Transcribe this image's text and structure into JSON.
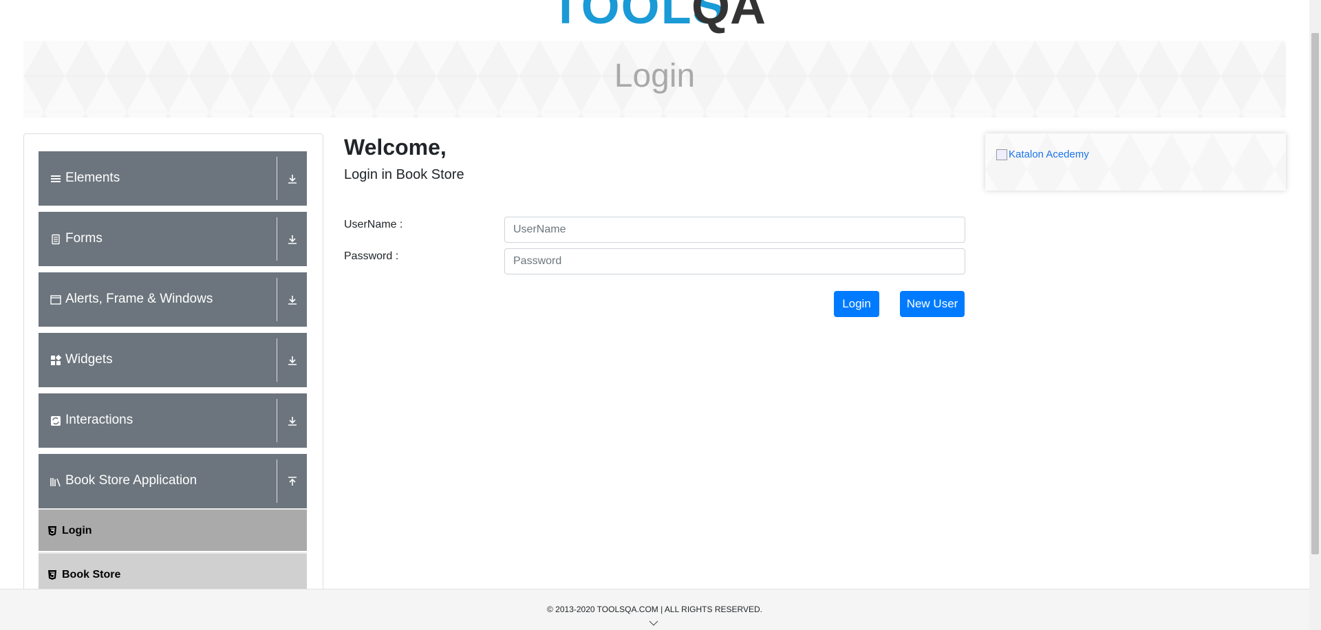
{
  "header": {
    "logo_text": "TOOLS",
    "logo_qa": "QA"
  },
  "banner": {
    "title": "Login"
  },
  "sidebar": {
    "groups": [
      {
        "label": "Elements",
        "icon": "menu-icon",
        "expanded": false
      },
      {
        "label": "Forms",
        "icon": "form-icon",
        "expanded": false
      },
      {
        "label": "Alerts, Frame & Windows",
        "icon": "window-icon",
        "expanded": false
      },
      {
        "label": "Widgets",
        "icon": "widgets-icon",
        "expanded": false
      },
      {
        "label": "Interactions",
        "icon": "interactions-icon",
        "expanded": false
      },
      {
        "label": "Book Store Application",
        "icon": "books-icon",
        "expanded": true
      }
    ],
    "sub_items": [
      {
        "label": "Login",
        "active": true
      },
      {
        "label": "Book Store",
        "active": false
      }
    ]
  },
  "main": {
    "welcome": "Welcome,",
    "subtitle": "Login in Book Store",
    "username_label": "UserName :",
    "username_placeholder": "UserName",
    "password_label": "Password :",
    "password_placeholder": "Password",
    "login_button": "Login",
    "new_user_button": "New User"
  },
  "ad": {
    "alt_text": "Katalon Acedemy"
  },
  "footer": {
    "text": "© 2013-2020 TOOLSQA.COM | ALL RIGHTS RESERVED."
  },
  "colors": {
    "sidebar_group": "#6c757d",
    "sub_item_active": "#aaaaaa",
    "sub_item_inactive": "#d0d0d0",
    "primary_button": "#007bff",
    "logo_blue": "#1a9ad6"
  }
}
